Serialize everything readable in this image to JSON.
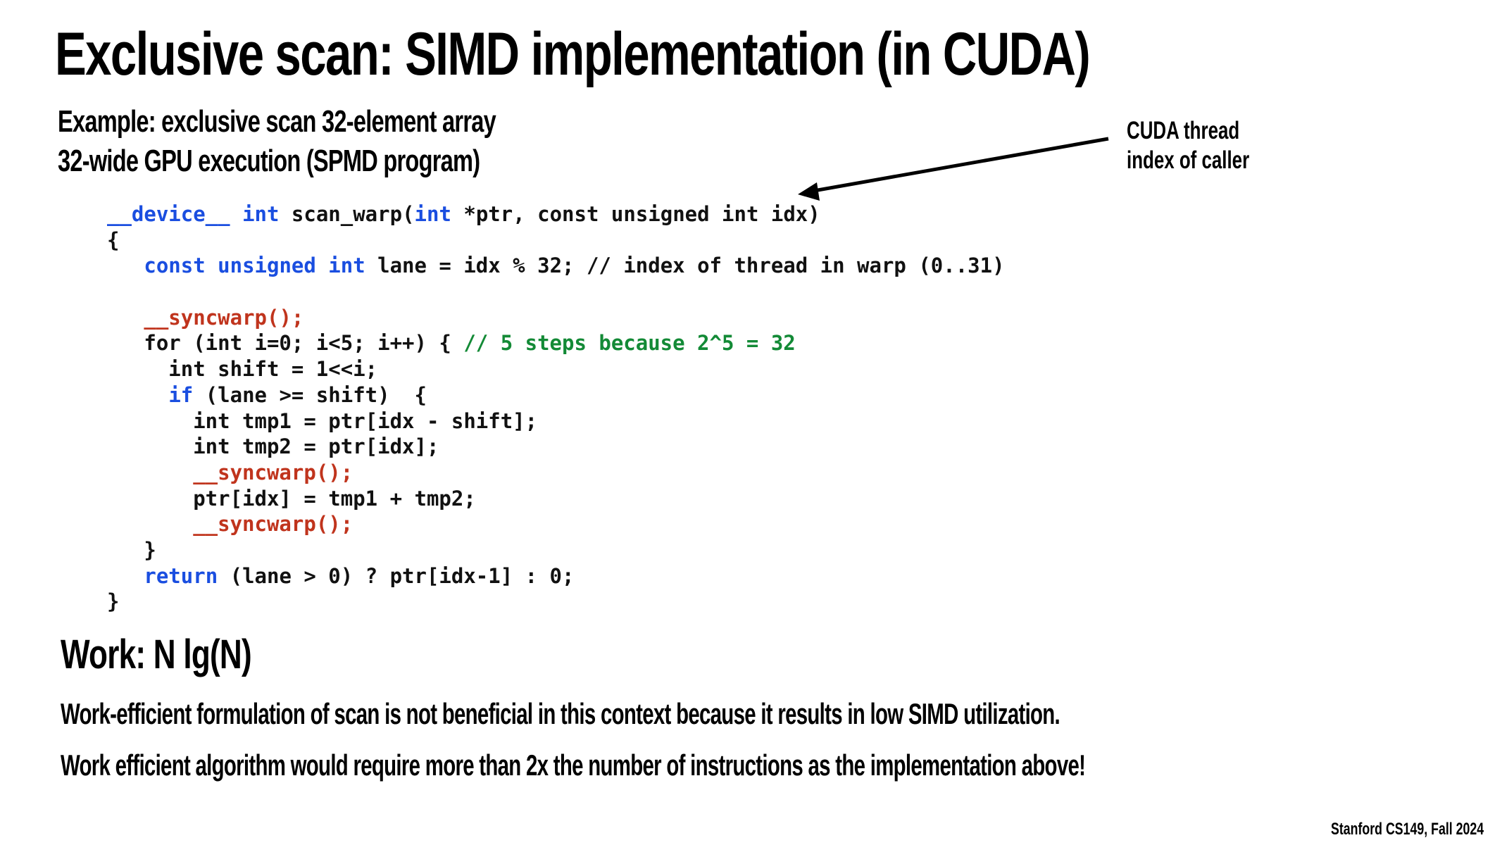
{
  "slide": {
    "title": "Exclusive scan: SIMD implementation (in CUDA)",
    "subtitle_lines": [
      "Example: exclusive scan 32-element array",
      "32-wide GPU execution (SPMD program)"
    ],
    "annotation": {
      "lines": [
        "CUDA thread",
        "index of caller"
      ],
      "icon": "arrow-left-icon"
    },
    "code": {
      "colors": {
        "keyword": "#1a4ee0",
        "sync": "#c0341d",
        "comment": "#138a36",
        "plain": "#111111"
      },
      "lines": [
        [
          {
            "t": "__device__",
            "c": "kw"
          },
          {
            "t": " ",
            "c": "plain"
          },
          {
            "t": "int",
            "c": "kw"
          },
          {
            "t": " scan_warp(",
            "c": "plain"
          },
          {
            "t": "int",
            "c": "kw"
          },
          {
            "t": " *ptr, const unsigned int idx)",
            "c": "plain"
          }
        ],
        [
          {
            "t": "{",
            "c": "plain"
          }
        ],
        [
          {
            "t": "   ",
            "c": "plain"
          },
          {
            "t": "const unsigned int",
            "c": "kw"
          },
          {
            "t": " lane = idx % 32; // index of thread in warp (0..31)",
            "c": "plain"
          }
        ],
        [
          {
            "t": "",
            "c": "plain"
          }
        ],
        [
          {
            "t": "   ",
            "c": "plain"
          },
          {
            "t": "__syncwarp();",
            "c": "sync"
          }
        ],
        [
          {
            "t": "   for (int i=0; i<5; i++) { ",
            "c": "plain"
          },
          {
            "t": "// 5 steps because 2^5 = 32",
            "c": "cmt"
          }
        ],
        [
          {
            "t": "     int shift = 1<<i;",
            "c": "plain"
          }
        ],
        [
          {
            "t": "     ",
            "c": "plain"
          },
          {
            "t": "if",
            "c": "kw"
          },
          {
            "t": " (lane >= shift)  {",
            "c": "plain"
          }
        ],
        [
          {
            "t": "       int tmp1 = ptr[idx - shift];",
            "c": "plain"
          }
        ],
        [
          {
            "t": "       int tmp2 = ptr[idx];",
            "c": "plain"
          }
        ],
        [
          {
            "t": "       ",
            "c": "plain"
          },
          {
            "t": "__syncwarp();",
            "c": "sync"
          }
        ],
        [
          {
            "t": "       ptr[idx] = tmp1 + tmp2;",
            "c": "plain"
          }
        ],
        [
          {
            "t": "       ",
            "c": "plain"
          },
          {
            "t": "__syncwarp();",
            "c": "sync"
          }
        ],
        [
          {
            "t": "   }",
            "c": "plain"
          }
        ],
        [
          {
            "t": "   ",
            "c": "plain"
          },
          {
            "t": "return",
            "c": "kw"
          },
          {
            "t": " (lane > 0) ? ptr[idx-1] : 0;",
            "c": "plain"
          }
        ],
        [
          {
            "t": "}",
            "c": "plain"
          }
        ]
      ]
    },
    "work_line": "Work:  N lg(N)",
    "bullets": [
      "Work-efficient formulation of scan is not beneficial in this context because it results in low SIMD utilization.",
      "Work efficient algorithm would require more than 2x the number of instructions as the implementation above!"
    ],
    "footer": "Stanford CS149, Fall 2024"
  }
}
